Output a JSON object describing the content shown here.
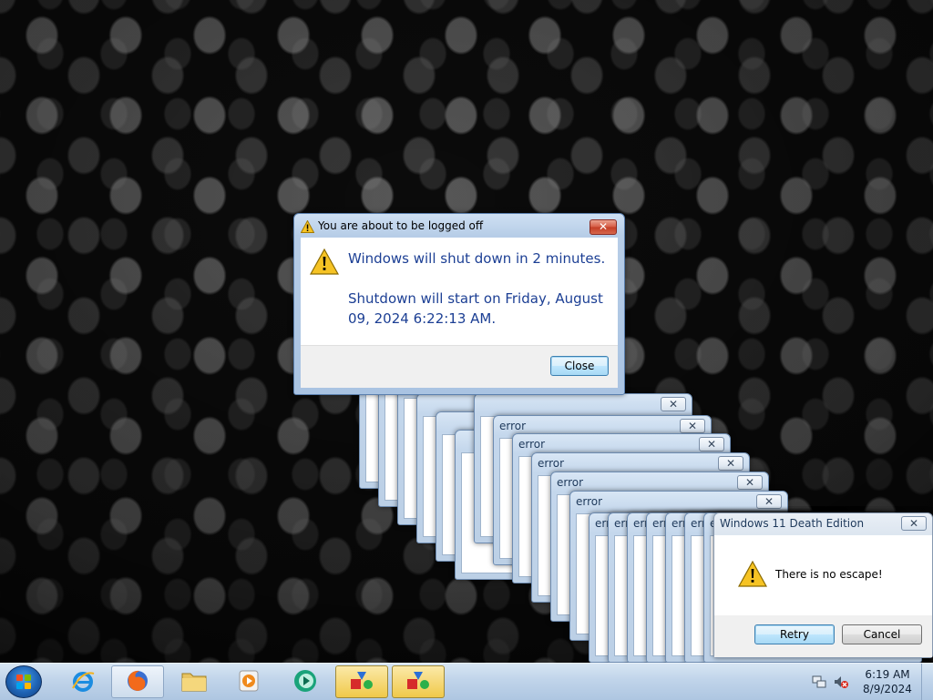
{
  "shutdown_dialog": {
    "title": "You are about to be logged off",
    "message": "Windows will shut down in 2 minutes.",
    "detail": "Shutdown will start on Friday, August 09, 2024 6:22:13 AM.",
    "close_label": "Close",
    "x_label": "✕"
  },
  "error_windows": [
    {
      "title": ""
    },
    {
      "title": ""
    },
    {
      "title": ""
    },
    {
      "title": "error"
    },
    {
      "title": "error"
    },
    {
      "title": "error"
    },
    {
      "title": "error"
    },
    {
      "title": "error"
    },
    {
      "title": "error"
    },
    {
      "title": "err"
    },
    {
      "title": "err"
    },
    {
      "title": "err"
    },
    {
      "title": "err"
    },
    {
      "title": "err"
    },
    {
      "title": "err"
    }
  ],
  "death_dialog": {
    "title": "Windows 11 Death Edition",
    "message": "There is no escape!",
    "retry_label": "Retry",
    "cancel_label": "Cancel",
    "x_label": "✕"
  },
  "taskbar": {
    "pinned": [
      {
        "name": "internet-explorer-icon"
      },
      {
        "name": "firefox-icon"
      },
      {
        "name": "file-explorer-icon"
      },
      {
        "name": "media-player-icon"
      },
      {
        "name": "media-center-icon"
      },
      {
        "name": "shapes-app-icon"
      },
      {
        "name": "shapes-app-icon"
      }
    ],
    "clock_time": "6:19 AM",
    "clock_date": "8/9/2024"
  }
}
